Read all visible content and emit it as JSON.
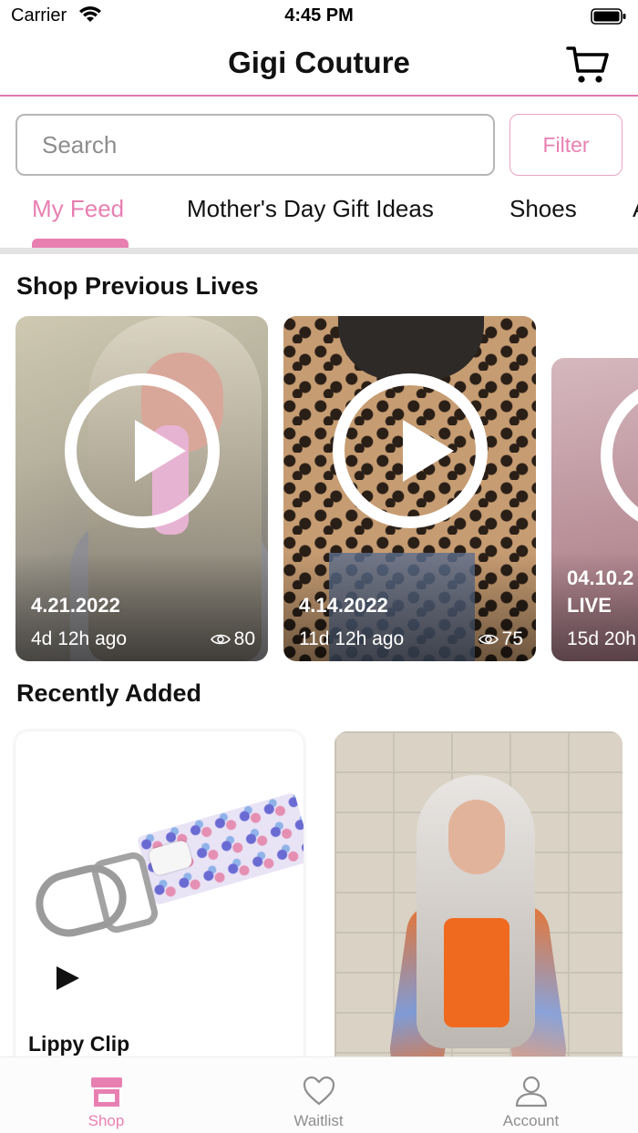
{
  "status_bar": {
    "carrier": "Carrier",
    "time": "4:45 PM"
  },
  "header": {
    "title": "Gigi Couture",
    "cart_icon": "shopping-cart-icon"
  },
  "search": {
    "placeholder": "Search",
    "filter_label": "Filter"
  },
  "category_tabs": [
    {
      "label": "My Feed",
      "active": true
    },
    {
      "label": "Mother's Day Gift Ideas",
      "active": false
    },
    {
      "label": "Shoes",
      "active": false
    },
    {
      "label": "A",
      "active": false
    }
  ],
  "previous_lives": {
    "title": "Shop Previous Lives",
    "cards": [
      {
        "date": "4.21.2022",
        "ago": "4d 12h ago",
        "views": "80"
      },
      {
        "date": "4.14.2022",
        "ago": "11d 12h ago",
        "views": "75"
      },
      {
        "date": "04.10.2",
        "subtitle": "LIVE",
        "ago": "15d 20h"
      }
    ]
  },
  "recently_added": {
    "title": "Recently Added",
    "products": [
      {
        "name": "Lippy Clip"
      }
    ]
  },
  "tab_bar": {
    "items": [
      {
        "label": "Shop",
        "icon": "store-icon",
        "active": true
      },
      {
        "label": "Waitlist",
        "icon": "heart-icon",
        "active": false
      },
      {
        "label": "Account",
        "icon": "person-icon",
        "active": false
      }
    ]
  },
  "colors": {
    "accent": "#e87fb1",
    "divider": "#e07aae",
    "inactive": "#8f8f8f"
  }
}
